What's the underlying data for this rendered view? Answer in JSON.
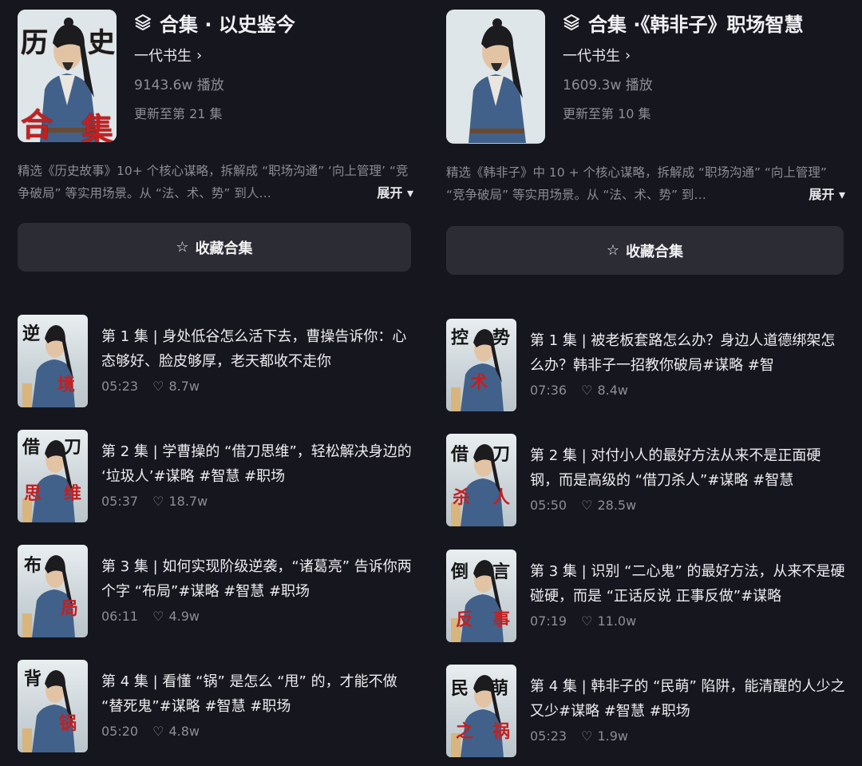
{
  "left": {
    "collection_title": "合集 · 以史鉴今",
    "author": "一代书生",
    "plays": "9143.6w 播放",
    "updated": "更新至第 21 集",
    "cover_chars": [
      "历",
      "史",
      "合",
      "集"
    ],
    "description": "精选《历史故事》10+ 个核心谋略，拆解成 “职场沟通” ‘向上管理’ “竞争破局” 等实用场景。从 “法、术、势” 到人…",
    "expand_label": "展开",
    "collect_label": "收藏合集",
    "episodes": [
      {
        "title": "第 1 集 | 身处低谷怎么活下去，曹操告诉你：心态够好、脸皮够厚，老天都收不走你",
        "duration": "05:23",
        "likes": "8.7w",
        "chars": [
          "逆",
          "境"
        ]
      },
      {
        "title": "第 2 集 | 学曹操的 “借刀思维”，轻松解决身边的 ‘垃圾人’#谋略 #智慧 #职场",
        "duration": "05:37",
        "likes": "18.7w",
        "chars": [
          "借",
          "刀",
          "思",
          "维"
        ]
      },
      {
        "title": "第 3 集 | 如何实现阶级逆袭，“诸葛亮” 告诉你两个字 “布局”#谋略 #智慧 #职场",
        "duration": "06:11",
        "likes": "4.9w",
        "chars": [
          "布",
          "局"
        ]
      },
      {
        "title": "第 4 集 | 看懂 “锅” 是怎么 “甩” 的，才能不做 “替死鬼”#谋略 #智慧 #职场",
        "duration": "05:20",
        "likes": "4.8w",
        "chars": [
          "背",
          "锅"
        ]
      }
    ]
  },
  "right": {
    "collection_title": "合集 ·《韩非子》职场智慧",
    "author": "一代书生",
    "plays": "1609.3w 播放",
    "updated": "更新至第 10 集",
    "description": "精选《韩非子》中 10 + 个核心谋略，拆解成 “职场沟通” “向上管理” “竞争破局” 等实用场景。从 “法、术、势” 到…",
    "expand_label": "展开",
    "collect_label": "收藏合集",
    "episodes": [
      {
        "title": "第 1 集 | 被老板套路怎么办？身边人道德绑架怎么办？韩非子一招教你破局#谋略 #智",
        "duration": "07:36",
        "likes": "8.4w",
        "chars": [
          "控",
          "势",
          "术"
        ]
      },
      {
        "title": "第 2 集 | 对付小人的最好方法从来不是正面硬钢，而是高级的 “借刀杀人”#谋略 #智慧",
        "duration": "05:50",
        "likes": "28.5w",
        "chars": [
          "借",
          "刀",
          "杀",
          "人"
        ]
      },
      {
        "title": "第 3 集 | 识别 “二心鬼” 的最好方法，从来不是硬碰硬，而是 “正话反说 正事反做”#谋略",
        "duration": "07:19",
        "likes": "11.0w",
        "chars": [
          "倒",
          "言",
          "反",
          "事"
        ]
      },
      {
        "title": "第 4 集 | 韩非子的 “民萌” 陷阱，能清醒的人少之又少#谋略 #智慧 #职场",
        "duration": "05:23",
        "likes": "1.9w",
        "chars": [
          "民",
          "萌",
          "之",
          "祸"
        ]
      }
    ]
  }
}
